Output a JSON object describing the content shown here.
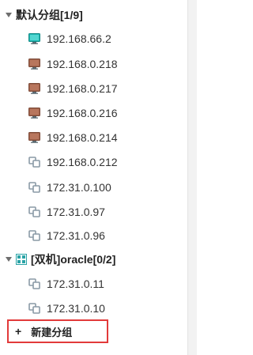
{
  "groups": [
    {
      "label": "默认分组[1/9]",
      "hosts": [
        {
          "ip": "192.168.66.2",
          "icon": "monitor-online-icon",
          "status": "online"
        },
        {
          "ip": "192.168.0.218",
          "icon": "monitor-offline-icon",
          "status": "offline"
        },
        {
          "ip": "192.168.0.217",
          "icon": "monitor-offline-icon",
          "status": "offline"
        },
        {
          "ip": "192.168.0.216",
          "icon": "monitor-offline-icon",
          "status": "offline"
        },
        {
          "ip": "192.168.0.214",
          "icon": "monitor-offline-icon",
          "status": "offline"
        },
        {
          "ip": "192.168.0.212",
          "icon": "linked-host-icon",
          "status": "unknown"
        },
        {
          "ip": "172.31.0.100",
          "icon": "linked-host-icon",
          "status": "unknown"
        },
        {
          "ip": "172.31.0.97",
          "icon": "linked-host-icon",
          "status": "unknown"
        },
        {
          "ip": "172.31.0.96",
          "icon": "linked-host-icon",
          "status": "unknown"
        }
      ]
    },
    {
      "label": "[双机]oracle[0/2]",
      "hosts": [
        {
          "ip": "172.31.0.11",
          "icon": "linked-host-icon",
          "status": "unknown"
        },
        {
          "ip": "172.31.0.10",
          "icon": "linked-host-icon",
          "status": "unknown"
        }
      ]
    }
  ],
  "new_group": {
    "plus": "+",
    "label": "新建分组"
  },
  "colors": {
    "online": "#1fb5b0",
    "offline": "#a0624b",
    "linked": "#8a9aa6",
    "highlight_border": "#e23a3a"
  }
}
